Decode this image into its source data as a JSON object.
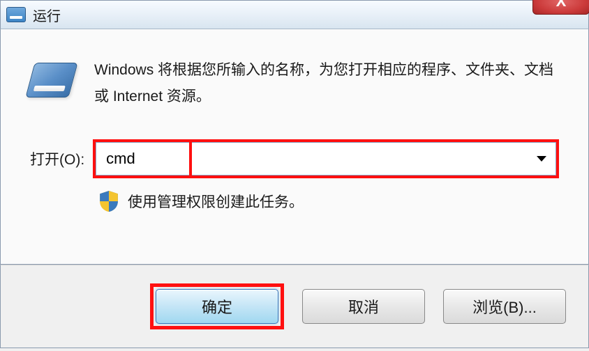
{
  "titlebar": {
    "title": "运行",
    "close_label": "X"
  },
  "body": {
    "description": "Windows 将根据您所输入的名称，为您打开相应的程序、文件夹、文档或 Internet 资源。",
    "open_label": "打开(O):",
    "open_value": "cmd",
    "admin_text": "使用管理权限创建此任务。"
  },
  "buttons": {
    "ok": "确定",
    "cancel": "取消",
    "browse": "浏览(B)..."
  }
}
